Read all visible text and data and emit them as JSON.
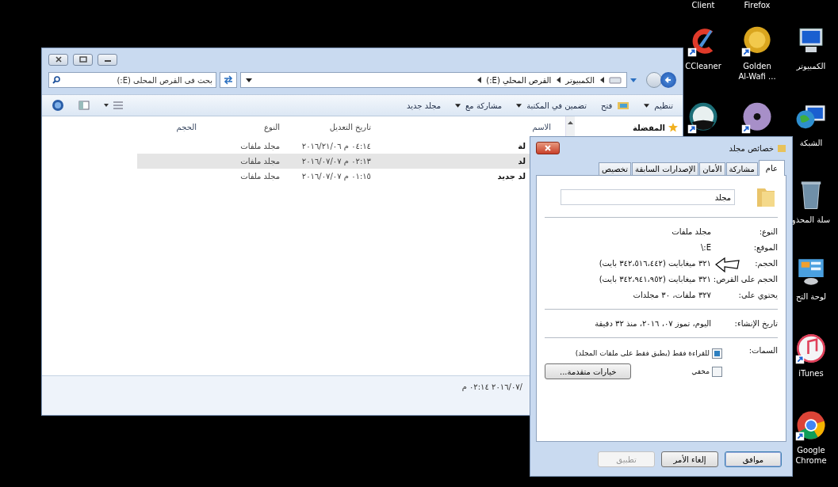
{
  "desktop_icon_columns": [
    [
      {
        "label": "الكمبيوتر",
        "kind": "computer",
        "shortcut": false
      },
      {
        "label": "الشبكة",
        "kind": "network",
        "shortcut": false
      },
      {
        "label": "سلة المحذو",
        "kind": "recycle-bin",
        "shortcut": false
      },
      {
        "label": "لوحة التح",
        "kind": "control-panel",
        "shortcut": false
      },
      {
        "label": "iTunes",
        "kind": "music",
        "shortcut": true
      },
      {
        "label": "Google\nChrome",
        "kind": "chrome",
        "shortcut": true
      }
    ],
    [
      {
        "label": "Firefox",
        "kind": "none"
      },
      {
        "label": "Golden\nAl-Wafi ...",
        "kind": "coin-logo",
        "shortcut": true
      },
      {
        "kind": "dvd",
        "shortcut": true
      }
    ],
    [
      {
        "label": "Client",
        "kind": "none"
      },
      {
        "label": "CCleaner",
        "kind": "c-logo",
        "shortcut": true
      },
      {
        "kind": "n-logo",
        "shortcut": true
      }
    ]
  ],
  "explorer": {
    "address": {
      "crumbs": [
        "الكمبيوتر",
        "القرص المحلي (E:)"
      ]
    },
    "search": {
      "placeholder": "بحث في القرص المحلي (E:)"
    },
    "toolbar": [
      {
        "label": "تنظيم",
        "has_menu": true,
        "icon": false
      },
      {
        "label": "فتح",
        "has_menu": false,
        "icon": true
      },
      {
        "label": "تضمين في المكتبة",
        "has_menu": true,
        "icon": false
      },
      {
        "label": "مشاركة مع",
        "has_menu": true,
        "icon": false
      },
      {
        "label": "مجلد جديد",
        "has_menu": false,
        "icon": false
      }
    ],
    "nav": [
      {
        "label": "المفضلة"
      }
    ],
    "columns": [
      "الاسم",
      "تاريخ التعديل",
      "النوع",
      "الحجم"
    ],
    "rows": [
      {
        "name": "لة",
        "modified": "٠٤:١٤ م ٢٠١٦/٢١/٠٦",
        "type": "مجلد ملفات",
        "selected": false
      },
      {
        "name": "لد",
        "modified": "٠٢:١٣ م ٢٠١٦/٠٧/٠٧",
        "type": "مجلد ملفات",
        "selected": true
      },
      {
        "name": "لد جديد",
        "modified": "٠١:١٥ م ٢٠١٦/٠٧/٠٧",
        "type": "مجلد ملفات",
        "selected": false
      }
    ],
    "details": "م ٠٢:١٤ ٢٠١٦/٠٧/"
  },
  "properties": {
    "title": "خصائص مجلد",
    "tabs": [
      {
        "label": "عام",
        "selected": true
      },
      {
        "label": "مشاركة",
        "selected": false
      },
      {
        "label": "الأمان",
        "selected": false
      },
      {
        "label": "الإصدارات السابقة",
        "selected": false
      },
      {
        "label": "تخصيص",
        "selected": false
      }
    ],
    "name": "مجلد",
    "groups": [
      [
        {
          "label": "النوع:",
          "value": "مجلد ملفات"
        },
        {
          "label": "الموقع:",
          "value": "E:\\"
        },
        {
          "label": "الحجم:",
          "value": "٣٢١ ميغابايت (٣٤٢،٥١٦،٤٤٢ بايت)"
        },
        {
          "label": "الحجم على القرص:",
          "value": "٣٢١ ميغابايت (٣٤٢،٩٤١،٩٥٢ بايت)"
        },
        {
          "label": "يحتوي على:",
          "value": "٣٢٧ ملفات، ٣٠ مجلدات"
        }
      ],
      [
        {
          "label": "تاريخ الإنشاء:",
          "value": "اليوم، تموز ٠٧، ٢٠١٦، منذ ٣٢ دقيقة"
        }
      ]
    ],
    "attributes_label": "السمات:",
    "attributes": [
      {
        "label": "للقراءة فقط (يطبق فقط على ملفات المجلد)",
        "checked": true
      },
      {
        "label": "مخفي",
        "checked": false
      }
    ],
    "advanced_button": "خيارات متقدمة...",
    "buttons": [
      {
        "label": "موافق",
        "disabled": false,
        "default": true
      },
      {
        "label": "إلغاء الأمر",
        "disabled": false,
        "default": false
      },
      {
        "label": "تطبيق",
        "disabled": true,
        "default": false
      }
    ]
  }
}
